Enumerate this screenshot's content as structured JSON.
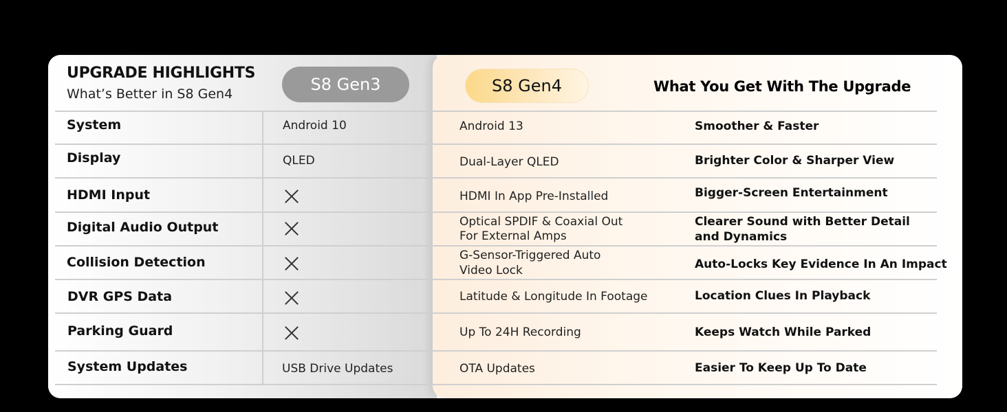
{
  "header": {
    "title": "UPGRADE HIGHLIGHTS",
    "subtitle": "What’s Better in S8 Gen4",
    "gen3_label": "S8 Gen3",
    "gen4_label": "S8 Gen4",
    "upgrade_heading": "What You Get With The Upgrade"
  },
  "rows": [
    {
      "feature": "System",
      "gen3": "Android 10",
      "gen4": "Android 13",
      "benefit": "Smoother & Faster"
    },
    {
      "feature": "Display",
      "gen3": "QLED",
      "gen4": "Dual-Layer QLED",
      "benefit": "Brighter Color & Sharper View"
    },
    {
      "feature": "HDMI Input",
      "gen3": "",
      "gen4": "HDMI In App Pre-Installed",
      "benefit": "Bigger-Screen Entertainment"
    },
    {
      "feature": "Digital Audio Output",
      "gen3": "",
      "gen4_l1": "Optical SPDIF & Coaxial Out",
      "gen4_l2": "For External Amps",
      "benefit_l1": "Clearer Sound with Better Detail",
      "benefit_l2": "and Dynamics"
    },
    {
      "feature": "Collision Detection",
      "gen3": "",
      "gen4_l1": "G-Sensor-Triggered Auto",
      "gen4_l2": "Video Lock",
      "benefit": "Auto-Locks Key Evidence In An Impact"
    },
    {
      "feature": "DVR GPS Data",
      "gen3": "",
      "gen4": "Latitude & Longitude In Footage",
      "benefit": "Location Clues In Playback"
    },
    {
      "feature": "Parking Guard",
      "gen3": "",
      "gen4": "Up To 24H Recording",
      "benefit": "Keeps Watch While Parked"
    },
    {
      "feature": "System Updates",
      "gen3": "USB Drive Updates",
      "gen4": "OTA Updates",
      "benefit": "Easier To Keep Up To Date"
    }
  ],
  "icons": {
    "unavailable": "x-icon"
  }
}
